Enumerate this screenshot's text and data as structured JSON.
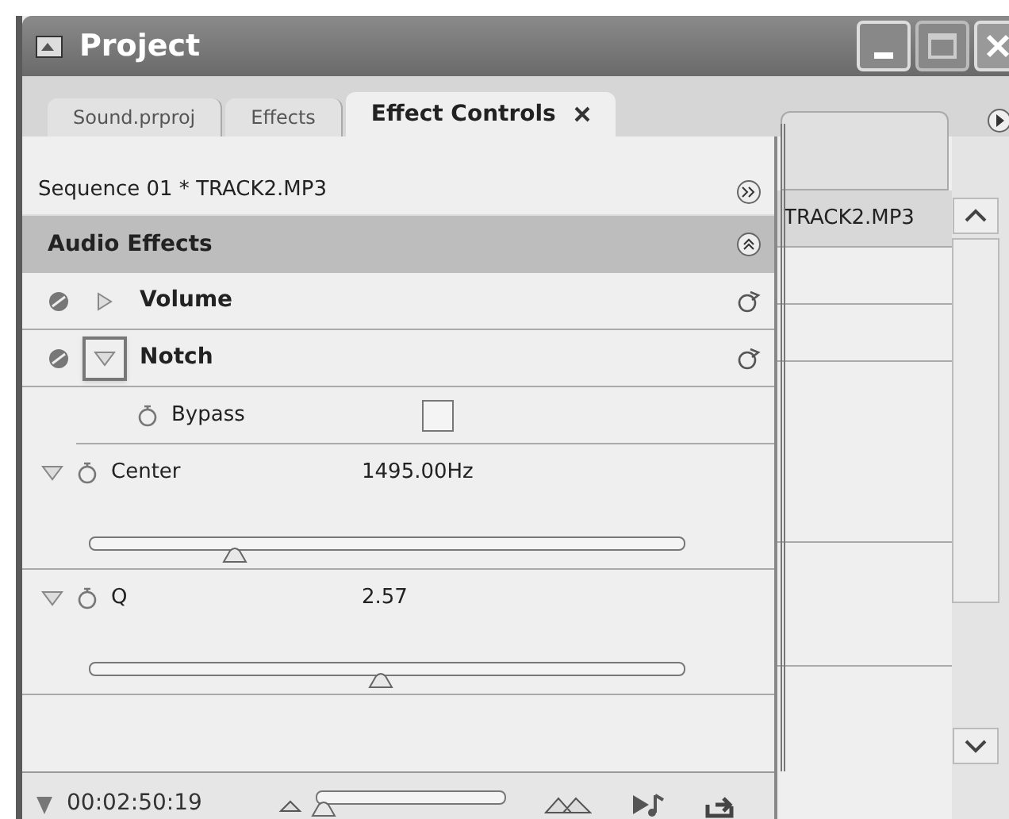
{
  "window": {
    "title": "Project"
  },
  "tabs": [
    {
      "label": "Sound.prproj",
      "selected": false
    },
    {
      "label": "Effects",
      "selected": false
    },
    {
      "label": "Effect Controls",
      "selected": true
    }
  ],
  "sequence": "Sequence 01 * TRACK2.MP3",
  "section": {
    "title": "Audio Effects"
  },
  "effects": [
    {
      "name": "Volume",
      "expanded": false,
      "focused": false
    },
    {
      "name": "Notch",
      "expanded": true,
      "focused": true
    }
  ],
  "params": [
    {
      "kind": "checkbox",
      "name": "Bypass",
      "checked": false
    },
    {
      "kind": "slider",
      "name": "Center",
      "value": "1495.00Hz",
      "expanded": true,
      "level": 0.245
    },
    {
      "kind": "slider",
      "name": "Q",
      "value": "2.57",
      "expanded": true,
      "level": 0.49
    }
  ],
  "timeline": {
    "clip": "TRACK2.MP3"
  },
  "footer": {
    "timecode": "00:02:50:19",
    "zoom": {
      "level": 0.04
    }
  }
}
